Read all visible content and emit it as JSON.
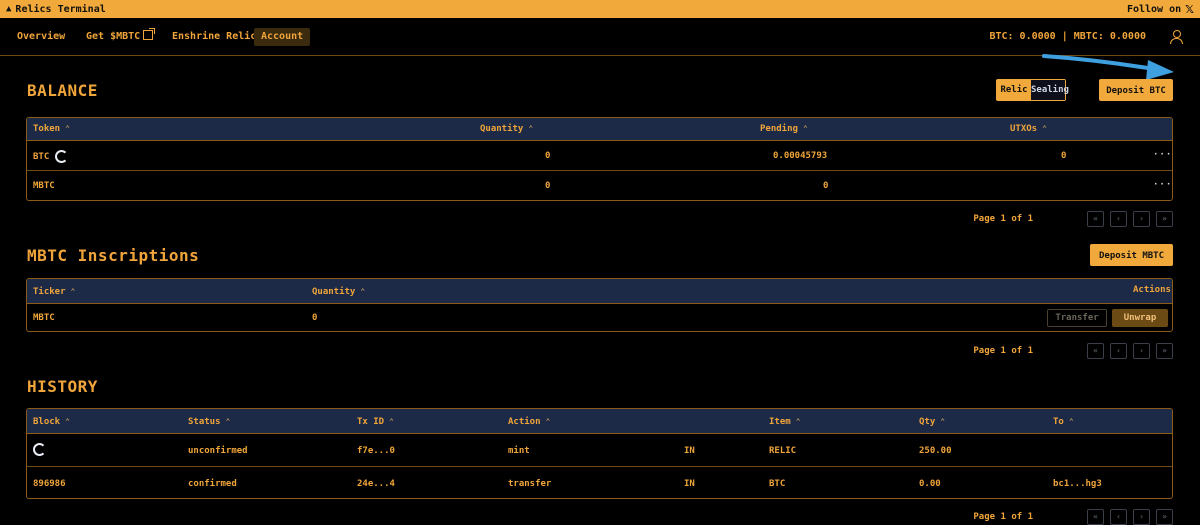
{
  "titlebar": {
    "title": "Relics Terminal",
    "follow": "Follow on",
    "x_glyph": "𝕏"
  },
  "nav": {
    "items": [
      {
        "label": "Overview"
      },
      {
        "label": "Get $MBTC"
      },
      {
        "label": "Enshrine Relic"
      },
      {
        "label": "Account"
      }
    ],
    "active": "Account",
    "balances": "BTC: 0.0000 | MBTC: 0.0000"
  },
  "balance": {
    "title": "BALANCE",
    "toggle": [
      "Relic",
      "Sealing"
    ],
    "deposit_label": "Deposit BTC",
    "headers": [
      "Token",
      "Quantity",
      "Pending",
      "UTXOs"
    ],
    "rows": [
      {
        "token": "BTC",
        "quantity": "0",
        "pending": "0.00045793",
        "utxos": "0",
        "more": "···"
      },
      {
        "token": "MBTC",
        "quantity": "0",
        "pending": "0",
        "utxos": "",
        "more": "···"
      }
    ],
    "page_label": "Page 1 of 1"
  },
  "inscriptions": {
    "title": "MBTC Inscriptions",
    "deposit_label": "Deposit MBTC",
    "headers": [
      "Ticker",
      "Quantity"
    ],
    "actions_header": "Actions",
    "rows": [
      {
        "ticker": "MBTC",
        "quantity": "0",
        "transfer": "Transfer",
        "unwrap": "Unwrap"
      }
    ],
    "page_label": "Page 1 of 1"
  },
  "history": {
    "title": "HISTORY",
    "headers": [
      "Block",
      "Status",
      "Tx ID",
      "Action",
      "Item",
      "Qty",
      "To"
    ],
    "rows": [
      {
        "block": "",
        "status": "unconfirmed",
        "txid": "f7e...0",
        "action": "mint",
        "direction": "IN",
        "item": "RELIC",
        "qty": "250.00",
        "to": ""
      },
      {
        "block": "896986",
        "status": "confirmed",
        "txid": "24e...4",
        "action": "transfer",
        "direction": "IN",
        "item": "BTC",
        "qty": "0.00",
        "to": "bc1...hg3"
      }
    ],
    "page_label": "Page 1 of 1"
  },
  "pager_icons": [
    "«",
    "‹",
    "›",
    "»"
  ],
  "colors": {
    "accent": "#f2a93b",
    "header_bg": "#1c2a48",
    "background": "#000000"
  }
}
